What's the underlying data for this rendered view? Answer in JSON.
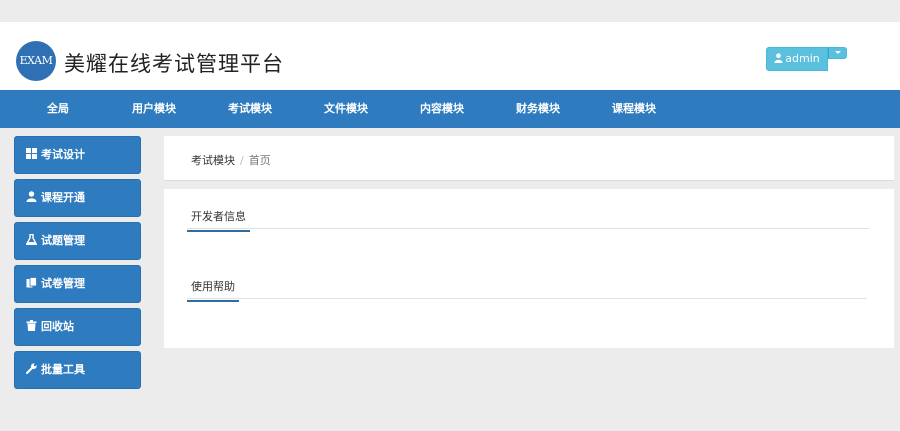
{
  "header": {
    "logo_text": "EXAM",
    "title": "美耀在线考试管理平台",
    "user_label": "admin"
  },
  "nav": {
    "items": [
      "全局",
      "用户模块",
      "考试模块",
      "文件模块",
      "内容模块",
      "财务模块",
      "课程模块"
    ]
  },
  "sidebar": {
    "items": [
      {
        "label": "考试设计",
        "icon": "grid-icon"
      },
      {
        "label": "课程开通",
        "icon": "user-icon"
      },
      {
        "label": "试题管理",
        "icon": "flask-icon"
      },
      {
        "label": "试卷管理",
        "icon": "copy-icon"
      },
      {
        "label": "回收站",
        "icon": "trash-icon"
      },
      {
        "label": "批量工具",
        "icon": "wrench-icon"
      }
    ]
  },
  "breadcrumb": {
    "module": "考试模块",
    "separator": "/",
    "current": "首页"
  },
  "content": {
    "sections": [
      "开发者信息",
      "使用帮助"
    ]
  },
  "colors": {
    "primary": "#2e7bbf",
    "info": "#5bc0de",
    "background": "#ececec"
  }
}
